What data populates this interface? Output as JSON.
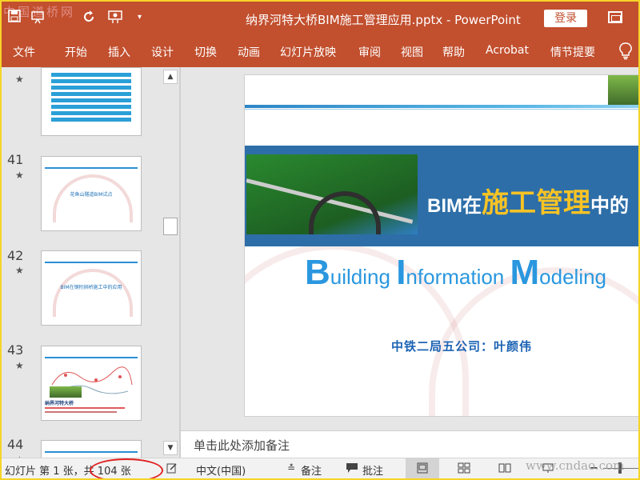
{
  "watermark_logo": "中国道桥网",
  "title": {
    "doc_title": "纳界河特大桥BIM施工管理应用.pptx  -  PowerPoint",
    "login": "登录"
  },
  "ribbon_tabs": [
    "文件",
    "开始",
    "插入",
    "设计",
    "切换",
    "动画",
    "幻灯片放映",
    "审阅",
    "视图",
    "帮助",
    "Acrobat",
    "情节提要"
  ],
  "thumbnails": [
    {
      "number": "",
      "star": "★"
    },
    {
      "number": "41",
      "star": "★",
      "title": "花鱼山隧道BIM试点"
    },
    {
      "number": "42",
      "star": "★",
      "title": "BIM在钢桁拱桥施工中的应用"
    },
    {
      "number": "43",
      "star": "★",
      "title": "纳界河特大桥"
    },
    {
      "number": "44",
      "star": "★"
    }
  ],
  "slide": {
    "banner_prefix": "BIM在",
    "banner_highlight": "施工管理",
    "banner_suffix": "中的",
    "bim_b": "B",
    "bim_uilding": "uilding ",
    "bim_i": "I",
    "bim_nformation": "nformation ",
    "bim_m": "M",
    "bim_odeling": "odeling",
    "author": "中铁二局五公司：叶颜伟"
  },
  "notes_placeholder": "单击此处添加备注",
  "status": {
    "slide_count": "幻灯片 第 1 张，共 104 张",
    "language": "中文(中国)",
    "notes": "备注",
    "comments": "批注"
  },
  "site_watermark": "www.cndao.com",
  "colors": {
    "titlebar": "#c24f2e",
    "accent_blue": "#2a97df",
    "highlight": "#f7c325",
    "annotation": "#e02020"
  }
}
